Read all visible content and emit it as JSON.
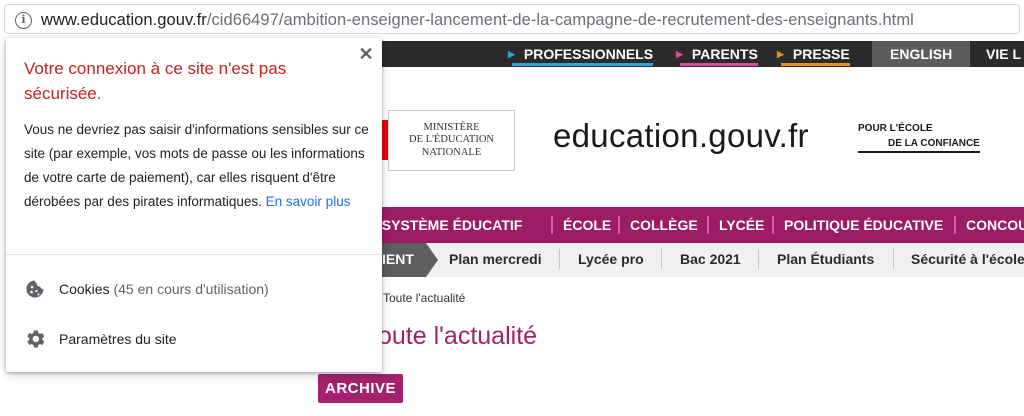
{
  "address_bar": {
    "url_host": "www.education.gouv.fr",
    "url_path": "/cid66497/ambition-enseigner-lancement-de-la-campagne-de-recrutement-des-enseignants.html",
    "info_icon": "info-icon"
  },
  "site": {
    "top_nav": [
      {
        "label": "PROFESSIONNELS",
        "color": "#2ea3d6"
      },
      {
        "label": "PARENTS",
        "color": "#d84c9e"
      },
      {
        "label": "PRESSE",
        "color": "#e2922b"
      },
      {
        "label": "ENGLISH"
      },
      {
        "label": "VIE L"
      }
    ],
    "ministry_logo": [
      "MINISTÈRE",
      "DE L'ÉDUCATION",
      "NATIONALE"
    ],
    "brand": "education.gouv.fr",
    "tagline": [
      "POUR L'ÉCOLE",
      "DE LA CONFIANCE"
    ],
    "main_nav": [
      "LE SYSTÈME ÉDUCATIF",
      "ÉCOLE",
      "COLLÈGE",
      "LYCÉE",
      "POLITIQUE ÉDUCATIVE",
      "CONCOU"
    ],
    "sub_nav_active": "IENT",
    "sub_nav": [
      "Plan mercredi",
      "Lycée pro",
      "Bac 2021",
      "Plan Étudiants",
      "Sécurité à l'école"
    ],
    "breadcrumb": "Toute l'actualité",
    "page_title": "oute l'actualité",
    "archive_badge": "ARCHIVE",
    "colors": {
      "nav_purple": "#9b1d66",
      "title_purple": "#a3206e",
      "dark_bar": "#2b2b2b"
    }
  },
  "popup": {
    "title": "Votre connexion à ce site n'est pas sécurisée.",
    "body": "Vous ne devriez pas saisir d'informations sensibles sur ce site (par exemple, vos mots de passe ou les informations de votre carte de paiement), car elles risquent d'être dérobées par des pirates informatiques.",
    "learn_more": "En savoir plus",
    "cookies_label": "Cookies",
    "cookies_count": "(45 en cours d'utilisation)",
    "settings_label": "Paramètres du site",
    "title_color": "#c5221f",
    "link_color": "#1a73e8"
  }
}
